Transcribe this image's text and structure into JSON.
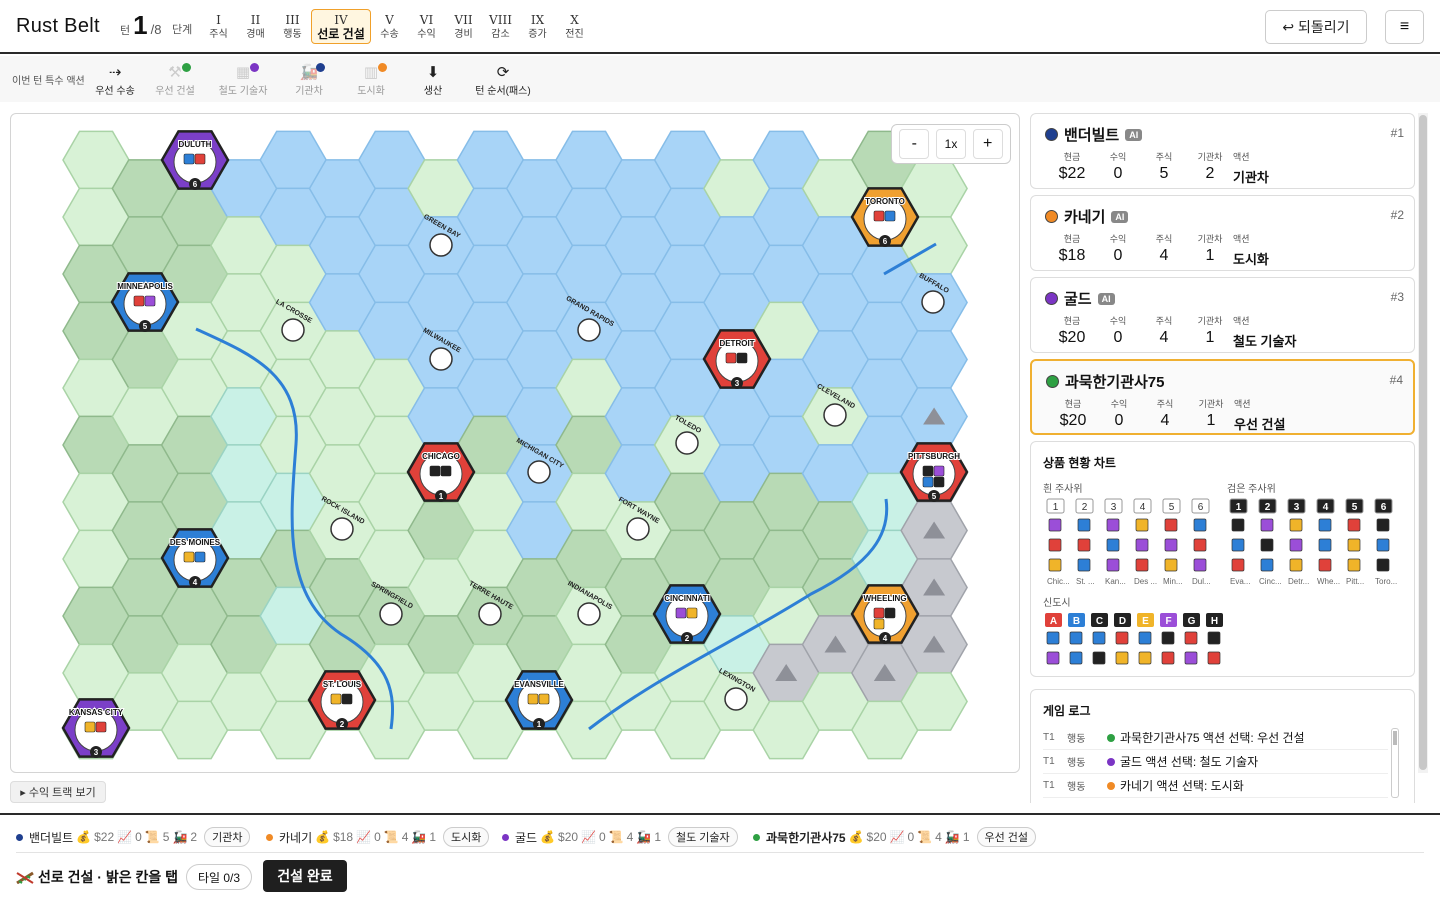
{
  "header": {
    "app_title": "Rust Belt",
    "turn_label": "턴",
    "turn_current": "1",
    "turn_total": "/8",
    "phase_label": "단계",
    "phases": [
      {
        "roman": "I",
        "name": "주식"
      },
      {
        "roman": "II",
        "name": "경매"
      },
      {
        "roman": "III",
        "name": "행동"
      },
      {
        "roman": "IV",
        "name": "선로 건설"
      },
      {
        "roman": "V",
        "name": "수송"
      },
      {
        "roman": "VI",
        "name": "수익"
      },
      {
        "roman": "VII",
        "name": "경비"
      },
      {
        "roman": "VIII",
        "name": "감소"
      },
      {
        "roman": "IX",
        "name": "증가"
      },
      {
        "roman": "X",
        "name": "전진"
      }
    ],
    "active_phase_index": 3,
    "undo_label": "↩ 되돌리기",
    "menu_icon": "≡"
  },
  "actions": {
    "label": "이번 턴 특수 액션",
    "items": [
      {
        "label": "우선 수송",
        "icon": "first-move-icon"
      },
      {
        "label": "우선 건설",
        "icon": "hammer-icon",
        "owner_color": "#2ea043"
      },
      {
        "label": "철도 기술자",
        "icon": "engineer-icon",
        "owner_color": "#7b35c4"
      },
      {
        "label": "기관차",
        "icon": "locomotive-icon",
        "owner_color": "#1f3f8f"
      },
      {
        "label": "도시화",
        "icon": "city-icon",
        "owner_color": "#f08a25"
      },
      {
        "label": "생산",
        "icon": "production-icon"
      },
      {
        "label": "턴 순서(패스)",
        "icon": "turn-order-icon"
      }
    ]
  },
  "map": {
    "zoom_minus": "-",
    "zoom_level": "1x",
    "zoom_plus": "+",
    "cities": [
      {
        "name": "DULUTH",
        "color": "purple",
        "value": "6",
        "cubes": [
          "#2d7fd6",
          "#e0413a"
        ]
      },
      {
        "name": "TORONTO",
        "color": "orange",
        "value": "6",
        "cubes": [
          "#e0413a",
          "#2d7fd6"
        ]
      },
      {
        "name": "MINNEAPOLIS",
        "color": "blue",
        "value": "5",
        "cubes": [
          "#e0413a",
          "#9b4ed8"
        ]
      },
      {
        "name": "DETROIT",
        "color": "red",
        "value": "3",
        "cubes": [
          "#e0413a",
          "#222222"
        ]
      },
      {
        "name": "CHICAGO",
        "color": "red",
        "value": "1",
        "cubes": [
          "#222222",
          "#222222"
        ]
      },
      {
        "name": "PITTSBURGH",
        "color": "red",
        "value": "5",
        "cubes": [
          "#222222",
          "#9b4ed8",
          "#2d7fd6",
          "#222222"
        ]
      },
      {
        "name": "DES MOINES",
        "color": "blue",
        "value": "4",
        "cubes": [
          "#f0b429",
          "#2d7fd6"
        ]
      },
      {
        "name": "CINCINNATI",
        "color": "blue",
        "value": "2",
        "cubes": [
          "#9b4ed8",
          "#f0b429"
        ]
      },
      {
        "name": "WHEELING",
        "color": "orange",
        "value": "4",
        "cubes": [
          "#e0413a",
          "#222222",
          "#f0b429"
        ]
      },
      {
        "name": "ST. LOUIS",
        "color": "red",
        "value": "2",
        "cubes": [
          "#f0b429",
          "#222222"
        ]
      },
      {
        "name": "EVANSVILLE",
        "color": "blue",
        "value": "1",
        "cubes": [
          "#f0b429",
          "#f0b429"
        ]
      },
      {
        "name": "KANSAS CITY",
        "color": "purple",
        "value": "3",
        "cubes": [
          "#f0b429",
          "#e0413a"
        ]
      }
    ],
    "towns": [
      "GREEN BAY",
      "LA CROSSE",
      "MILWAUKEE",
      "GRAND RAPIDS",
      "BUFFALO",
      "CLEVELAND",
      "TOLEDO",
      "MICHIGAN CITY",
      "ROCK ISLAND",
      "FORT WAYNE",
      "SPRINGFIELD",
      "TERRE HAUTE",
      "INDIANAPOLIS",
      "LEXINGTON"
    ]
  },
  "income_track_button": "▸ 수익 트랙 보기",
  "players": [
    {
      "name": "밴더빌트",
      "color": "#1f3f8f",
      "ai": "AI",
      "rank": "#1",
      "cash": "$22",
      "income": "0",
      "shares": "5",
      "locomotive": "2",
      "action": "기관차",
      "current": false
    },
    {
      "name": "카네기",
      "color": "#f08a25",
      "ai": "AI",
      "rank": "#2",
      "cash": "$18",
      "income": "0",
      "shares": "4",
      "locomotive": "1",
      "action": "도시화",
      "current": false
    },
    {
      "name": "굴드",
      "color": "#7b35c4",
      "ai": "AI",
      "rank": "#3",
      "cash": "$20",
      "income": "0",
      "shares": "4",
      "locomotive": "1",
      "action": "철도 기술자",
      "current": false
    },
    {
      "name": "과묵한기관사75",
      "color": "#2ea043",
      "ai": "",
      "rank": "#4",
      "cash": "$20",
      "income": "0",
      "shares": "4",
      "locomotive": "1",
      "action": "우선 건설",
      "current": true
    }
  ],
  "stat_labels": {
    "cash": "현금",
    "income": "수익",
    "shares": "주식",
    "locomotive": "기관차",
    "action": "액션"
  },
  "goods_chart": {
    "title": "상품 현황 차트",
    "white_label": "흰 주사위",
    "black_label": "검은 주사위",
    "new_city_label": "신도시",
    "white_cols": [
      {
        "num": "1",
        "cubes": [
          "#9b4ed8",
          "#e0413a",
          "#f0b429"
        ],
        "city": "Chic..."
      },
      {
        "num": "2",
        "cubes": [
          "#2d7fd6",
          "#e0413a",
          "#2d7fd6"
        ],
        "city": "St. ..."
      },
      {
        "num": "3",
        "cubes": [
          "#9b4ed8",
          "#2d7fd6",
          "#9b4ed8"
        ],
        "city": "Kan..."
      },
      {
        "num": "4",
        "cubes": [
          "#f0b429",
          "#9b4ed8",
          "#e0413a"
        ],
        "city": "Des ..."
      },
      {
        "num": "5",
        "cubes": [
          "#e0413a",
          "#9b4ed8",
          "#f0b429"
        ],
        "city": "Min..."
      },
      {
        "num": "6",
        "cubes": [
          "#2d7fd6",
          "#e0413a",
          "#9b4ed8"
        ],
        "city": "Dul..."
      }
    ],
    "black_cols": [
      {
        "num": "1",
        "cubes": [
          "#222222",
          "#2d7fd6",
          "#e0413a"
        ],
        "city": "Eva..."
      },
      {
        "num": "2",
        "cubes": [
          "#9b4ed8",
          "#222222",
          "#2d7fd6"
        ],
        "city": "Cinc..."
      },
      {
        "num": "3",
        "cubes": [
          "#f0b429",
          "#9b4ed8",
          "#f0b429"
        ],
        "city": "Detr..."
      },
      {
        "num": "4",
        "cubes": [
          "#2d7fd6",
          "#2d7fd6",
          "#e0413a"
        ],
        "city": "Whe..."
      },
      {
        "num": "5",
        "cubes": [
          "#e0413a",
          "#f0b429",
          "#f0b429"
        ],
        "city": "Pitt..."
      },
      {
        "num": "6",
        "cubes": [
          "#222222",
          "#2d7fd6",
          "#222222"
        ],
        "city": "Toro..."
      }
    ],
    "new_cities": [
      {
        "letter": "A",
        "color": "#e0413a",
        "cubes": [
          "#2d7fd6",
          "#9b4ed8"
        ]
      },
      {
        "letter": "B",
        "color": "#2d7fd6",
        "cubes": [
          "#2d7fd6",
          "#2d7fd6"
        ]
      },
      {
        "letter": "C",
        "color": "#222222",
        "cubes": [
          "#2d7fd6",
          "#222222"
        ]
      },
      {
        "letter": "D",
        "color": "#222222",
        "cubes": [
          "#e0413a",
          "#f0b429"
        ]
      },
      {
        "letter": "E",
        "color": "#f0b429",
        "cubes": [
          "#2d7fd6",
          "#f0b429"
        ]
      },
      {
        "letter": "F",
        "color": "#9b4ed8",
        "cubes": [
          "#222222",
          "#e0413a"
        ]
      },
      {
        "letter": "G",
        "color": "#222222",
        "cubes": [
          "#e0413a",
          "#9b4ed8"
        ]
      },
      {
        "letter": "H",
        "color": "#222222",
        "cubes": [
          "#222222",
          "#e0413a"
        ]
      }
    ]
  },
  "game_log": {
    "title": "게임 로그",
    "entries": [
      {
        "turn": "T1",
        "phase": "행동",
        "color": "#2ea043",
        "text": "과묵한기관사75 액션 선택: 우선 건설"
      },
      {
        "turn": "T1",
        "phase": "행동",
        "color": "#7b35c4",
        "text": "굴드 액션 선택: 철도 기술자"
      },
      {
        "turn": "T1",
        "phase": "행동",
        "color": "#f08a25",
        "text": "카네기 액션 선택: 도시화"
      }
    ]
  },
  "footer": {
    "players": [
      {
        "name": "밴더빌트",
        "color": "#1f3f8f",
        "cash": "$22",
        "income": "0",
        "shares": "5",
        "loco": "2",
        "action": "기관차"
      },
      {
        "name": "카네기",
        "color": "#f08a25",
        "cash": "$18",
        "income": "0",
        "shares": "4",
        "loco": "1",
        "action": "도시화"
      },
      {
        "name": "굴드",
        "color": "#7b35c4",
        "cash": "$20",
        "income": "0",
        "shares": "4",
        "loco": "1",
        "action": "철도 기술자"
      },
      {
        "name": "과묵한기관사75",
        "color": "#2ea043",
        "cash": "$20",
        "income": "0",
        "shares": "4",
        "loco": "1",
        "action": "우선 건설"
      }
    ],
    "build_title": "선로 건설 · 밝은 칸을 탭",
    "tile_chip": "타일 0/3",
    "done_label": "건설 완료"
  }
}
